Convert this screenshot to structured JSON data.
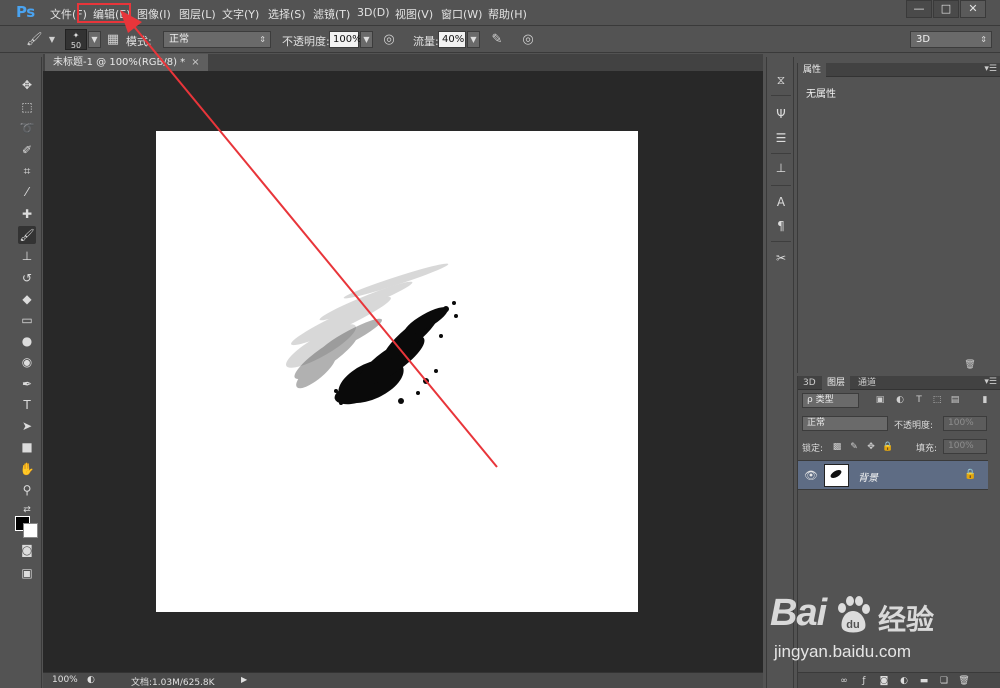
{
  "app": {
    "logo": "Ps"
  },
  "menu": {
    "items": [
      "文件(F)",
      "编辑(E)",
      "图像(I)",
      "图层(L)",
      "文字(Y)",
      "选择(S)",
      "滤镜(T)",
      "3D(D)",
      "视图(V)",
      "窗口(W)",
      "帮助(H)"
    ]
  },
  "window_controls": {
    "minimize": "—",
    "maximize": "□",
    "close": "✕"
  },
  "options": {
    "brush_size": "50",
    "mode_label": "模式:",
    "mode_value": "正常",
    "opacity_label": "不透明度:",
    "opacity_value": "100%",
    "flow_label": "流量:",
    "flow_value": "40%",
    "workspace": "3D"
  },
  "document": {
    "tab_title": "未标题-1 @ 100%(RGB/8) *",
    "tab_close": "×",
    "zoom": "100%",
    "doc_info": "文档:1.03M/625.8K"
  },
  "properties_panel": {
    "tab": "属性",
    "content": "无属性"
  },
  "layers_panel": {
    "tabs": [
      "3D",
      "图层",
      "通道"
    ],
    "filter_label": "ρ 类型",
    "blend_mode": "正常",
    "opacity_label": "不透明度:",
    "opacity_value": "100%",
    "lock_label": "锁定:",
    "fill_label": "填充:",
    "fill_value": "100%",
    "layer_name": "背景"
  },
  "watermark": {
    "brand": "Bai",
    "brand_suffix": "du",
    "product": "经验",
    "url": "jingyan.baidu.com"
  },
  "colors": {
    "highlight": "#e8353a",
    "ps_blue": "#4aa3f0",
    "layer_selected": "#5e6c84"
  }
}
